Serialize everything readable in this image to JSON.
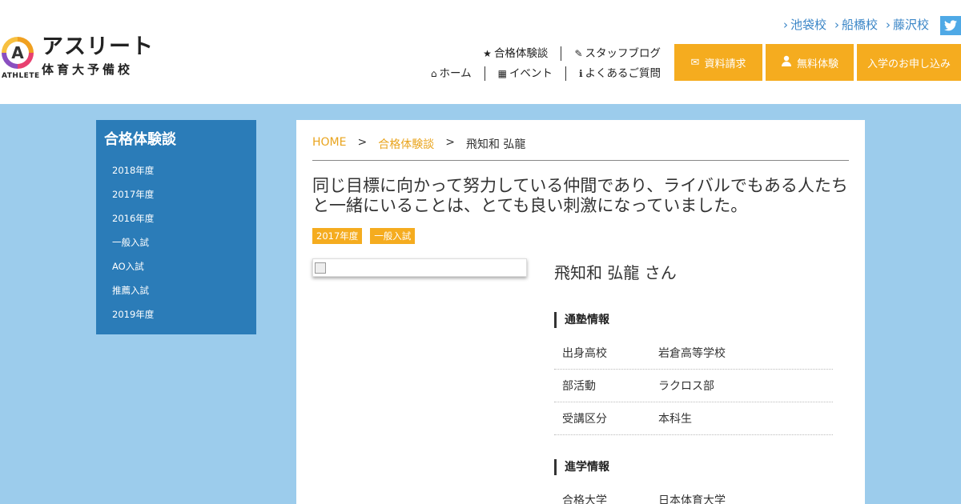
{
  "logo": {
    "mark_letter": "A",
    "sub": "ATHLETE",
    "main": "アスリート",
    "kanji": "体育大予備校"
  },
  "header": {
    "school_links": [
      "池袋校",
      "船橋校",
      "藤沢校"
    ],
    "twitter_icon": "twitter-icon",
    "nav_row1": [
      {
        "label": "合格体験談",
        "icon": "★"
      },
      {
        "label": "スタッフブログ",
        "icon": "✎"
      }
    ],
    "nav_row2": [
      {
        "label": "ホーム",
        "icon": "⌂"
      },
      {
        "label": "イベント",
        "icon": "▦"
      },
      {
        "label": "よくあるご質問",
        "icon": "ℹ"
      }
    ],
    "cta": {
      "docs": "資料請求",
      "trial": "無料体験",
      "apply": "入学のお申し込み"
    }
  },
  "sidebar": {
    "title": "合格体験談",
    "items": [
      "2018年度",
      "2017年度",
      "2016年度",
      "一般入試",
      "AO入試",
      "推薦入試",
      "2019年度"
    ]
  },
  "main": {
    "breadcrumb": {
      "home": "HOME",
      "sep": ">",
      "category": "合格体験談",
      "current": "飛知和 弘龍"
    },
    "headline": "同じ目標に向かって努力している仲間であり、ライバルでもある人たちと一緒にいることは、とても良い刺激になっていました。",
    "tags": [
      "2017年度",
      "一般入試"
    ],
    "person_name": "飛知和 弘龍 さん",
    "school_info": {
      "heading": "通塾情報",
      "rows": [
        {
          "k": "出身高校",
          "v": "岩倉高等学校"
        },
        {
          "k": "部活動",
          "v": "ラクロス部"
        },
        {
          "k": "受講区分",
          "v": "本科生"
        }
      ]
    },
    "advance_info": {
      "heading": "進学情報",
      "rows": [
        {
          "k": "合格大学",
          "v": "日本体育大学"
        }
      ]
    }
  },
  "colors": {
    "accent": "#f5ac1f",
    "sidebar": "#2b7cb8",
    "background": "#9cccec",
    "link": "#3b86c7"
  }
}
